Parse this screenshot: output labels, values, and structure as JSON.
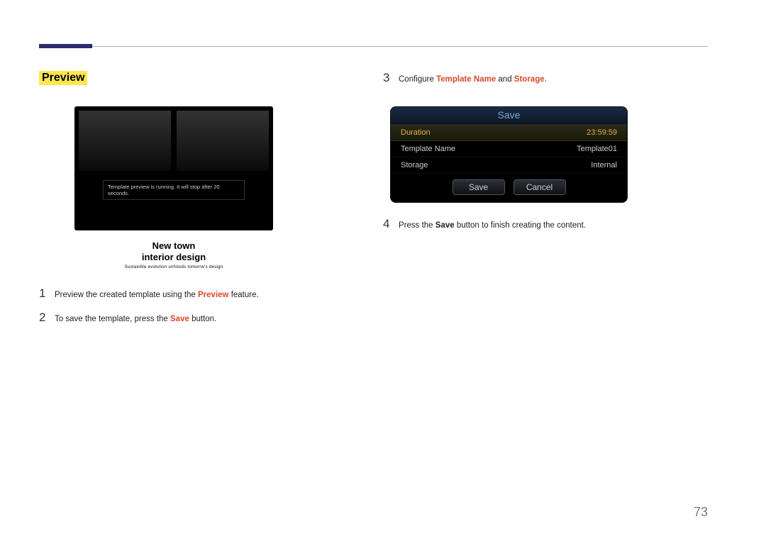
{
  "page_number": "73",
  "left": {
    "section_title": "Preview",
    "preview_toast": "Template preview is running. It will stop after 20 seconds.",
    "caption_line1": "New town",
    "caption_line2": "interior design",
    "caption_line3": "Sustainble evolution unfolods tomorrw's design",
    "steps": [
      {
        "num": "1",
        "pre": "Preview the created template using the ",
        "hl": "Preview",
        "post": " feature."
      },
      {
        "num": "2",
        "pre": "To save the template, press the ",
        "hl": "Save",
        "post": " button."
      }
    ]
  },
  "right": {
    "step3": {
      "num": "3",
      "pre": "Configure ",
      "hl1": "Template Name",
      "mid": " and ",
      "hl2": "Storage",
      "post": "."
    },
    "dialog": {
      "title": "Save",
      "rows": [
        {
          "label": "Duration",
          "value": "23:59:59",
          "selected": true
        },
        {
          "label": "Template Name",
          "value": "Template01",
          "selected": false
        },
        {
          "label": "Storage",
          "value": "Internal",
          "selected": false
        }
      ],
      "save_btn": "Save",
      "cancel_btn": "Cancel"
    },
    "step4": {
      "num": "4",
      "pre": "Press the ",
      "hl": "Save",
      "post": " button to finish creating the content."
    }
  }
}
